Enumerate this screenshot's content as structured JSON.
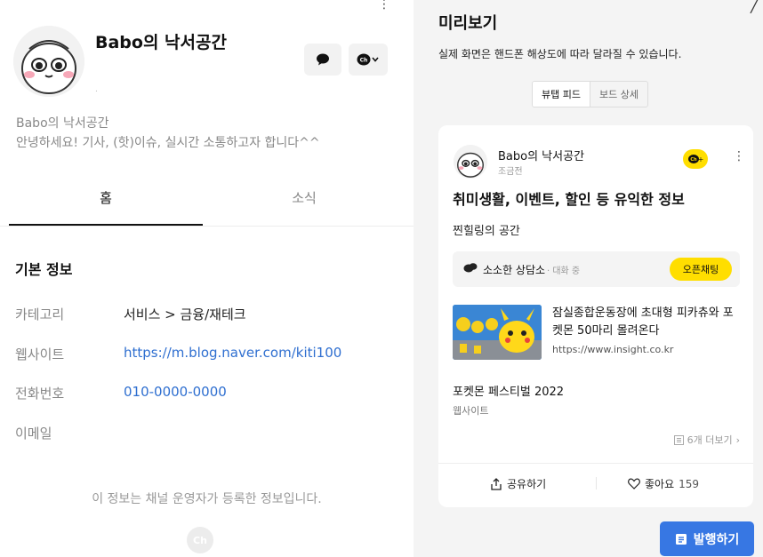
{
  "profile": {
    "name": "Babo의 낙서공간",
    "intro_name": "Babo의 낙서공간",
    "intro_desc": "안녕하세요! 기사, (핫)이슈, 실시간 소통하고자 합니다^^",
    "dot": "."
  },
  "tabs": [
    {
      "label": "홈",
      "active": true
    },
    {
      "label": "소식",
      "active": false
    }
  ],
  "basic_info": {
    "title": "기본 정보",
    "rows": [
      {
        "label": "카테고리",
        "value": "서비스 > 금융/재테크"
      },
      {
        "label": "웹사이트",
        "value": "https://m.blog.naver.com/kiti100"
      },
      {
        "label": "전화번호",
        "value": "010-0000-0000"
      },
      {
        "label": "이메일",
        "value": ""
      }
    ],
    "footer_note": "이 정보는 채널 운영자가 등록한 정보입니다.",
    "footer_logo": "Ch"
  },
  "preview": {
    "title": "미리보기",
    "subtitle": "실제 화면은 핸드폰 해상도에 따라 달라질 수 있습니다.",
    "segments": [
      {
        "label": "뷰탭 피드",
        "active": true
      },
      {
        "label": "보드 상세",
        "active": false
      }
    ],
    "card": {
      "name": "Babo의 낙서공간",
      "time": "조금전",
      "headline": "취미생활, 이벤트, 할인 등 유익한 정보",
      "text": "찐힐링의 공간",
      "openchat": {
        "name": "소소한 상담소",
        "status": "· 대화 중",
        "button": "오픈채팅"
      },
      "link": {
        "title": "잠실종합운동장에 초대형 피카츄와 포켓몬 50마리 몰려온다",
        "url": "https://www.insight.co.kr"
      },
      "festival": {
        "title": "포켓몬 페스티벌 2022",
        "sub": "웹사이트"
      },
      "more": "6개 더보기",
      "share": "공유하기",
      "like": "좋아요",
      "like_count": "159"
    },
    "publish": "발행하기"
  },
  "colors": {
    "accent_yellow": "#ffde00",
    "publish_blue": "#3777e3",
    "link_blue": "#2f6fd0"
  }
}
